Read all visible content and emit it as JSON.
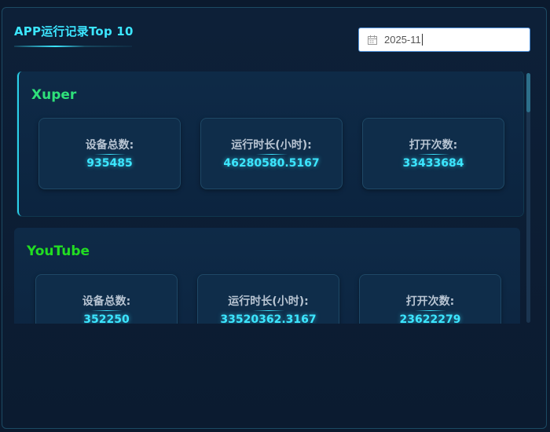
{
  "header": {
    "title": "APP运行记录Top 10"
  },
  "date_picker": {
    "value": "2025-11",
    "icon": "calendar-icon"
  },
  "labels": {
    "device_total": "设备总数:",
    "run_hours": "运行时长(小时):",
    "open_count": "打开次数:"
  },
  "apps": [
    {
      "name": "Xuper",
      "name_color": "#2fe07a",
      "device_total": "935485",
      "run_hours": "46280580.5167",
      "open_count": "33433684"
    },
    {
      "name": "YouTube",
      "name_color": "#22dd22",
      "device_total": "352250",
      "run_hours": "33520362.3167",
      "open_count": "23622279"
    }
  ],
  "colors": {
    "accent": "#3ce6ff",
    "background": "#0b1a2e",
    "card": "#0e2a47"
  }
}
